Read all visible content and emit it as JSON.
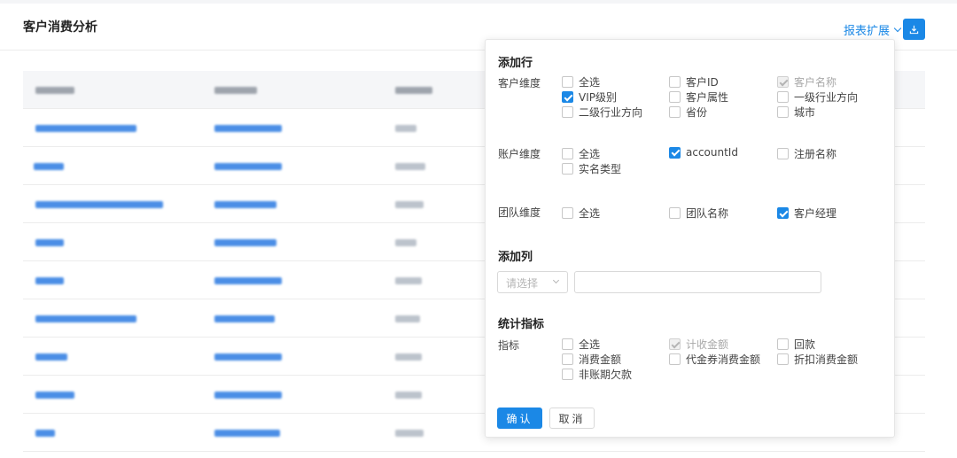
{
  "header": {
    "title": "客户消费分析",
    "export_label": "报表扩展",
    "download_icon": "download-icon"
  },
  "colors": {
    "accent": "#1b88e6",
    "border": "#d9d9d9",
    "disabled_text": "#a8a8a8"
  },
  "panel": {
    "add_rows": {
      "title": "添加行",
      "groups": [
        {
          "label": "客户维度",
          "options": [
            {
              "label": "全选",
              "checked": false,
              "disabled": false
            },
            {
              "label": "客户ID",
              "checked": false,
              "disabled": false
            },
            {
              "label": "客户名称",
              "checked": true,
              "disabled": true
            },
            {
              "label": "VIP级别",
              "checked": true,
              "disabled": false
            },
            {
              "label": "客户属性",
              "checked": false,
              "disabled": false
            },
            {
              "label": "一级行业方向",
              "checked": false,
              "disabled": false
            },
            {
              "label": "二级行业方向",
              "checked": false,
              "disabled": false
            },
            {
              "label": "省份",
              "checked": false,
              "disabled": false
            },
            {
              "label": "城市",
              "checked": false,
              "disabled": false
            }
          ]
        },
        {
          "label": "账户维度",
          "options": [
            {
              "label": "全选",
              "checked": false,
              "disabled": false
            },
            {
              "label": "accountId",
              "checked": true,
              "disabled": false
            },
            {
              "label": "注册名称",
              "checked": false,
              "disabled": false
            },
            {
              "label": "实名类型",
              "checked": false,
              "disabled": false
            }
          ]
        },
        {
          "label": "团队维度",
          "options": [
            {
              "label": "全选",
              "checked": false,
              "disabled": false
            },
            {
              "label": "团队名称",
              "checked": false,
              "disabled": false
            },
            {
              "label": "客户经理",
              "checked": true,
              "disabled": false
            }
          ]
        }
      ]
    },
    "add_columns": {
      "title": "添加列",
      "select_placeholder": "请选择",
      "input_value": ""
    },
    "metrics": {
      "title": "统计指标",
      "label": "指标",
      "options": [
        {
          "label": "全选",
          "checked": false,
          "disabled": false
        },
        {
          "label": "计收金额",
          "checked": true,
          "disabled": true
        },
        {
          "label": "回款",
          "checked": false,
          "disabled": false
        },
        {
          "label": "消费金额",
          "checked": false,
          "disabled": false
        },
        {
          "label": "代金券消费金额",
          "checked": false,
          "disabled": false
        },
        {
          "label": "折扣消费金额",
          "checked": false,
          "disabled": false
        },
        {
          "label": "非账期欠款",
          "checked": false,
          "disabled": false
        }
      ]
    },
    "confirm_label": "确认",
    "cancel_label": "取消"
  }
}
